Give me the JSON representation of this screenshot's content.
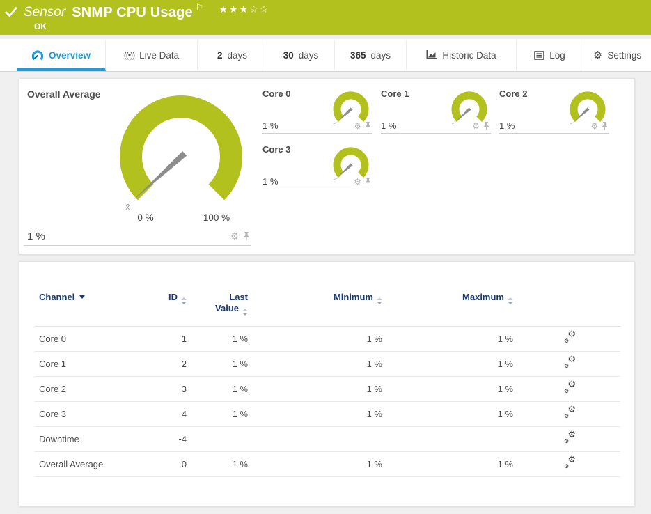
{
  "colors": {
    "brand_green": "#b2c11d",
    "accent_blue": "#1e9dd8",
    "header_navy": "#1b3a6e"
  },
  "header": {
    "object_type": "Sensor",
    "title": "SNMP CPU Usage",
    "status": "OK",
    "rating": {
      "filled": 3,
      "total": 5
    },
    "stars_filled": "★★★",
    "stars_empty": "☆☆",
    "flag_glyph": "⚐"
  },
  "tabs": {
    "overview": "Overview",
    "live_data": "Live Data",
    "d2_num": "2",
    "d2_unit": "days",
    "d30_num": "30",
    "d30_unit": "days",
    "d365_num": "365",
    "d365_unit": "days",
    "historic": "Historic Data",
    "log": "Log",
    "settings": "Settings",
    "live_icon_glyph": "((•))",
    "gear_glyph": "⚙"
  },
  "gauges": {
    "overall": {
      "title": "Overall Average",
      "value": 1,
      "value_label": "1 %",
      "min_label": "0 %",
      "max_label": "100 %",
      "avg_marker": "x̄"
    },
    "cores": [
      {
        "title": "Core 0",
        "value": 1,
        "value_label": "1 %"
      },
      {
        "title": "Core 1",
        "value": 1,
        "value_label": "1 %"
      },
      {
        "title": "Core 2",
        "value": 1,
        "value_label": "1 %"
      },
      {
        "title": "Core 3",
        "value": 1,
        "value_label": "1 %"
      }
    ],
    "gear_glyph": "⚙"
  },
  "chart_data": {
    "type": "gauge",
    "gauges": [
      {
        "name": "Overall Average",
        "value": 1,
        "min": 0,
        "max": 100,
        "unit": "%"
      },
      {
        "name": "Core 0",
        "value": 1,
        "min": 0,
        "max": 100,
        "unit": "%"
      },
      {
        "name": "Core 1",
        "value": 1,
        "min": 0,
        "max": 100,
        "unit": "%"
      },
      {
        "name": "Core 2",
        "value": 1,
        "min": 0,
        "max": 100,
        "unit": "%"
      },
      {
        "name": "Core 3",
        "value": 1,
        "min": 0,
        "max": 100,
        "unit": "%"
      }
    ]
  },
  "table": {
    "headers": {
      "channel": "Channel",
      "id": "ID",
      "last_line1": "Last",
      "last_line2": "Value",
      "minimum": "Minimum",
      "maximum": "Maximum"
    },
    "rows": [
      {
        "channel": "Core 0",
        "id": "1",
        "last": "1 %",
        "min": "1 %",
        "max": "1 %"
      },
      {
        "channel": "Core 1",
        "id": "2",
        "last": "1 %",
        "min": "1 %",
        "max": "1 %"
      },
      {
        "channel": "Core 2",
        "id": "3",
        "last": "1 %",
        "min": "1 %",
        "max": "1 %"
      },
      {
        "channel": "Core 3",
        "id": "4",
        "last": "1 %",
        "min": "1 %",
        "max": "1 %"
      },
      {
        "channel": "Downtime",
        "id": "-4",
        "last": "",
        "min": "",
        "max": ""
      },
      {
        "channel": "Overall Average",
        "id": "0",
        "last": "1 %",
        "min": "1 %",
        "max": "1 %"
      }
    ],
    "gears_glyph": "⚙"
  }
}
